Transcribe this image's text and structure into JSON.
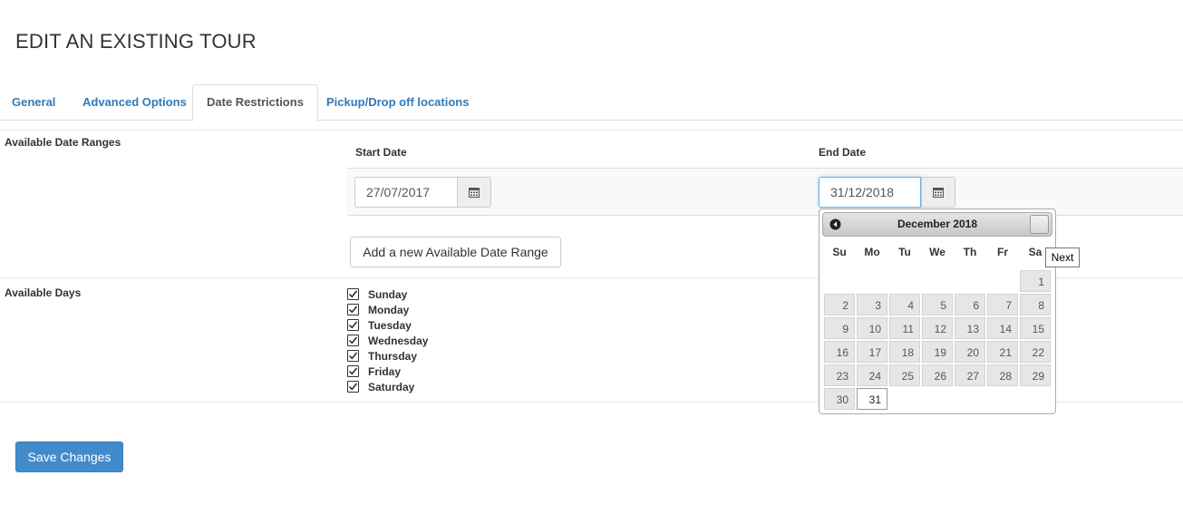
{
  "page": {
    "title": "EDIT AN EXISTING TOUR"
  },
  "tabs": [
    {
      "label": "General"
    },
    {
      "label": "Advanced Options"
    },
    {
      "label": "Date Restrictions",
      "active": true
    },
    {
      "label": "Pickup/Drop off locations"
    }
  ],
  "date_ranges": {
    "section_label": "Available Date Ranges",
    "start_label": "Start Date",
    "end_label": "End Date",
    "start_value": "27/07/2017",
    "end_value": "31/12/2018",
    "add_button": "Add a new Available Date Range"
  },
  "available_days": {
    "label": "Available Days",
    "days": [
      {
        "label": "Sunday",
        "checked": true
      },
      {
        "label": "Monday",
        "checked": true
      },
      {
        "label": "Tuesday",
        "checked": true
      },
      {
        "label": "Wednesday",
        "checked": true
      },
      {
        "label": "Thursday",
        "checked": true
      },
      {
        "label": "Friday",
        "checked": true
      },
      {
        "label": "Saturday",
        "checked": true
      }
    ]
  },
  "save_button": "Save Changes",
  "datepicker": {
    "title": "December 2018",
    "weekdays": [
      "Su",
      "Mo",
      "Tu",
      "We",
      "Th",
      "Fr",
      "Sa"
    ],
    "weeks": [
      [
        "",
        "",
        "",
        "",
        "",
        "",
        "1"
      ],
      [
        "2",
        "3",
        "4",
        "5",
        "6",
        "7",
        "8"
      ],
      [
        "9",
        "10",
        "11",
        "12",
        "13",
        "14",
        "15"
      ],
      [
        "16",
        "17",
        "18",
        "19",
        "20",
        "21",
        "22"
      ],
      [
        "23",
        "24",
        "25",
        "26",
        "27",
        "28",
        "29"
      ],
      [
        "30",
        "31",
        "",
        "",
        "",
        "",
        ""
      ]
    ],
    "current_day": "31",
    "next_tooltip": "Next"
  },
  "icons": {
    "calendar": "calendar-icon",
    "prev": "circle-triangle-w-icon",
    "check": "check-icon"
  },
  "colors": {
    "link": "#337ab7",
    "primary": "#428bca",
    "focus": "#66afe9"
  }
}
